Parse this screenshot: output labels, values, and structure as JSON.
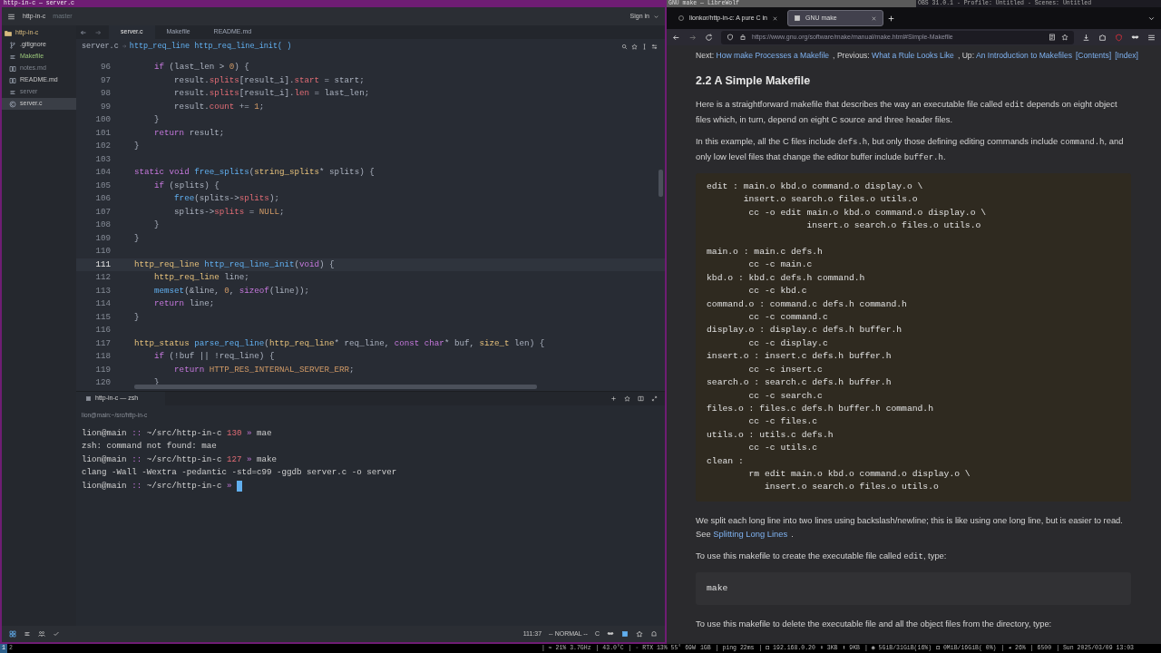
{
  "editor": {
    "window_title": "http-in-c — server.c",
    "project": "http-in-c",
    "branch": "master",
    "sign_in": "Sign in",
    "sidebar": {
      "root": "http-in-c",
      "items": [
        {
          "label": ".gitignore",
          "kind": "git",
          "added": false,
          "ignored": false,
          "selected": false
        },
        {
          "label": "Makefile",
          "kind": "lines",
          "added": true,
          "ignored": false,
          "selected": false
        },
        {
          "label": "notes.md",
          "kind": "book",
          "added": false,
          "ignored": true,
          "selected": false
        },
        {
          "label": "README.md",
          "kind": "book",
          "added": false,
          "ignored": false,
          "selected": false
        },
        {
          "label": "server",
          "kind": "lines",
          "added": false,
          "ignored": true,
          "selected": false
        },
        {
          "label": "server.c",
          "kind": "c",
          "added": false,
          "ignored": false,
          "selected": true
        }
      ]
    },
    "tabs": [
      {
        "label": "server.c",
        "selected": true
      },
      {
        "label": "Makefile",
        "selected": false
      },
      {
        "label": "README.md",
        "selected": false
      }
    ],
    "breadcrumb": [
      "server.c",
      "http_req_line http_req_line_init( )"
    ],
    "code": [
      {
        "n": "96",
        "current": false,
        "tokens": [
          {
            "kind": "keyword",
            "text": "    if"
          },
          {
            "kind": "plain",
            "text": " (last_len > "
          },
          {
            "kind": "number",
            "text": "0"
          },
          {
            "kind": "plain",
            "text": ") {"
          }
        ]
      },
      {
        "n": "97",
        "current": false,
        "tokens": [
          {
            "kind": "plain",
            "text": "        result."
          },
          {
            "kind": "member",
            "text": "splits"
          },
          {
            "kind": "plain",
            "text": "[result_i]."
          },
          {
            "kind": "member",
            "text": "start"
          },
          {
            "kind": "plain",
            "text": " = start;"
          }
        ]
      },
      {
        "n": "98",
        "current": false,
        "tokens": [
          {
            "kind": "plain",
            "text": "        result."
          },
          {
            "kind": "member",
            "text": "splits"
          },
          {
            "kind": "plain",
            "text": "[result_i]."
          },
          {
            "kind": "member",
            "text": "len"
          },
          {
            "kind": "plain",
            "text": " = last_len;"
          }
        ]
      },
      {
        "n": "99",
        "current": false,
        "tokens": [
          {
            "kind": "plain",
            "text": "        result."
          },
          {
            "kind": "member",
            "text": "count"
          },
          {
            "kind": "plain",
            "text": " += "
          },
          {
            "kind": "number",
            "text": "1"
          },
          {
            "kind": "plain",
            "text": ";"
          }
        ]
      },
      {
        "n": "100",
        "current": false,
        "tokens": [
          {
            "kind": "plain",
            "text": "    }"
          }
        ]
      },
      {
        "n": "101",
        "current": false,
        "tokens": [
          {
            "kind": "keyword",
            "text": "    return"
          },
          {
            "kind": "plain",
            "text": " result;"
          }
        ]
      },
      {
        "n": "102",
        "current": false,
        "tokens": [
          {
            "kind": "plain",
            "text": "}"
          }
        ]
      },
      {
        "n": "103",
        "current": false
      },
      {
        "n": "104",
        "current": false,
        "tokens": [
          {
            "kind": "keyword",
            "text": "static void"
          },
          {
            "kind": "function",
            "text": " free_splits"
          },
          {
            "kind": "plain",
            "text": "("
          },
          {
            "kind": "type",
            "text": "string_splits"
          },
          {
            "kind": "plain",
            "text": "* splits) {"
          }
        ]
      },
      {
        "n": "105",
        "current": false,
        "tokens": [
          {
            "kind": "keyword",
            "text": "    if"
          },
          {
            "kind": "plain",
            "text": " (splits) {"
          }
        ]
      },
      {
        "n": "106",
        "current": false,
        "tokens": [
          {
            "kind": "function",
            "text": "        free"
          },
          {
            "kind": "plain",
            "text": "(splits->"
          },
          {
            "kind": "member",
            "text": "splits"
          },
          {
            "kind": "plain",
            "text": ");"
          }
        ]
      },
      {
        "n": "107",
        "current": false,
        "tokens": [
          {
            "kind": "plain",
            "text": "        splits->"
          },
          {
            "kind": "member",
            "text": "splits"
          },
          {
            "kind": "plain",
            "text": " = "
          },
          {
            "kind": "number",
            "text": "NULL"
          },
          {
            "kind": "plain",
            "text": ";"
          }
        ]
      },
      {
        "n": "108",
        "current": false,
        "tokens": [
          {
            "kind": "plain",
            "text": "    }"
          }
        ]
      },
      {
        "n": "109",
        "current": false,
        "tokens": [
          {
            "kind": "plain",
            "text": "}"
          }
        ]
      },
      {
        "n": "110",
        "current": false
      },
      {
        "n": "111",
        "current": true,
        "tokens": [
          {
            "kind": "type",
            "text": "http_req_line"
          },
          {
            "kind": "function",
            "text": " http_req_line_init"
          },
          {
            "kind": "plain",
            "text": "("
          },
          {
            "kind": "keyword",
            "text": "void"
          },
          {
            "kind": "plain",
            "text": ") {"
          }
        ]
      },
      {
        "n": "112",
        "current": false,
        "tokens": [
          {
            "kind": "type",
            "text": "    http_req_line"
          },
          {
            "kind": "plain",
            "text": " line;"
          }
        ]
      },
      {
        "n": "113",
        "current": false,
        "tokens": [
          {
            "kind": "function",
            "text": "    memset"
          },
          {
            "kind": "plain",
            "text": "(&line, "
          },
          {
            "kind": "number",
            "text": "0"
          },
          {
            "kind": "plain",
            "text": ", "
          },
          {
            "kind": "keyword",
            "text": "sizeof"
          },
          {
            "kind": "plain",
            "text": "(line));"
          }
        ]
      },
      {
        "n": "114",
        "current": false,
        "tokens": [
          {
            "kind": "keyword",
            "text": "    return"
          },
          {
            "kind": "plain",
            "text": " line;"
          }
        ]
      },
      {
        "n": "115",
        "current": false,
        "tokens": [
          {
            "kind": "plain",
            "text": "}"
          }
        ]
      },
      {
        "n": "116",
        "current": false
      },
      {
        "n": "117",
        "current": false,
        "tokens": [
          {
            "kind": "type",
            "text": "http_status"
          },
          {
            "kind": "function",
            "text": " parse_req_line"
          },
          {
            "kind": "plain",
            "text": "("
          },
          {
            "kind": "type",
            "text": "http_req_line"
          },
          {
            "kind": "plain",
            "text": "* req_line, "
          },
          {
            "kind": "keyword",
            "text": "const char"
          },
          {
            "kind": "plain",
            "text": "* buf, "
          },
          {
            "kind": "type",
            "text": "size_t"
          },
          {
            "kind": "plain",
            "text": " len) {"
          }
        ]
      },
      {
        "n": "118",
        "current": false,
        "tokens": [
          {
            "kind": "keyword",
            "text": "    if"
          },
          {
            "kind": "plain",
            "text": " (!buf || !req_line) {"
          }
        ]
      },
      {
        "n": "119",
        "current": false,
        "tokens": [
          {
            "kind": "keyword",
            "text": "        return"
          },
          {
            "kind": "number",
            "text": " HTTP_RES_INTERNAL_SERVER_ERR"
          },
          {
            "kind": "plain",
            "text": ";"
          }
        ]
      },
      {
        "n": "120",
        "current": false,
        "tokens": [
          {
            "kind": "plain",
            "text": "    }"
          }
        ]
      }
    ],
    "terminal": {
      "tab": "http-in-c — zsh",
      "header": "lion@main:~/src/http-in-c",
      "lines": [
        {
          "kind": "prompt",
          "user": "lion@main",
          "sep": "::",
          "path": "~/src/http-in-c",
          "code": "130",
          "arrow": "»",
          "command": "mae"
        },
        {
          "kind": "output",
          "text": "zsh: command not found: mae"
        },
        {
          "kind": "prompt",
          "user": "lion@main",
          "sep": "::",
          "path": "~/src/http-in-c",
          "code": "127",
          "arrow": "»",
          "command": "make"
        },
        {
          "kind": "output",
          "text": "clang -Wall -Wextra -pedantic -std=c99 -ggdb server.c -o server"
        },
        {
          "kind": "prompt",
          "user": "lion@main",
          "sep": "::",
          "path": "~/src/http-in-c",
          "arrow": "»",
          "cursor": true
        }
      ]
    },
    "status": {
      "position": "111:37",
      "mode": "-- NORMAL --",
      "language": "C"
    }
  },
  "browser": {
    "window_title": "GNU make — LibreWolf",
    "obs_title": "OBS 31.0.1 - Profile: Untitled - Scenes: Untitled",
    "tabs": [
      {
        "label": "lionkor/http-in-c: A pure C in",
        "selected": false
      },
      {
        "label": "GNU make",
        "selected": true
      }
    ],
    "url": "https://www.gnu.org/software/make/manual/make.html#Simple-Makefile",
    "nav": [
      {
        "kind": "text",
        "text": "Next: "
      },
      {
        "kind": "link",
        "text": "How make Processes a Makefile"
      },
      {
        "kind": "text",
        "text": ", Previous: "
      },
      {
        "kind": "link",
        "text": "What a Rule Looks Like"
      },
      {
        "kind": "text",
        "text": ", Up: "
      },
      {
        "kind": "link",
        "text": "An Introduction to Makefiles"
      },
      {
        "kind": "link",
        "text": "[Contents]"
      },
      {
        "kind": "link",
        "text": "[Index]"
      }
    ],
    "heading": "2.2 A Simple Makefile",
    "blocks": [
      {
        "kind": "para",
        "parts": [
          {
            "kind": "text",
            "text": "Here is a straightforward makefile that describes the way an executable file called "
          },
          {
            "kind": "code",
            "text": "edit"
          },
          {
            "kind": "text",
            "text": " depends on eight object files which, in turn, depend on eight C source and three header files."
          }
        ]
      },
      {
        "kind": "para",
        "parts": [
          {
            "kind": "text",
            "text": "In this example, all the C files include "
          },
          {
            "kind": "code",
            "text": "defs.h"
          },
          {
            "kind": "text",
            "text": ", but only those defining editing commands include "
          },
          {
            "kind": "code",
            "text": "command.h"
          },
          {
            "kind": "text",
            "text": ", and only low level files that change the editor buffer include "
          },
          {
            "kind": "code",
            "text": "buffer.h"
          },
          {
            "kind": "text",
            "text": "."
          }
        ]
      },
      {
        "kind": "code_example",
        "text": "edit : main.o kbd.o command.o display.o \\\n       insert.o search.o files.o utils.o\n        cc -o edit main.o kbd.o command.o display.o \\\n                   insert.o search.o files.o utils.o\n\nmain.o : main.c defs.h\n        cc -c main.c\nkbd.o : kbd.c defs.h command.h\n        cc -c kbd.c\ncommand.o : command.c defs.h command.h\n        cc -c command.c\ndisplay.o : display.c defs.h buffer.h\n        cc -c display.c\ninsert.o : insert.c defs.h buffer.h\n        cc -c insert.c\nsearch.o : search.c defs.h buffer.h\n        cc -c search.c\nfiles.o : files.c defs.h buffer.h command.h\n        cc -c files.c\nutils.o : utils.c defs.h\n        cc -c utils.c\nclean :\n        rm edit main.o kbd.o command.o display.o \\\n           insert.o search.o files.o utils.o"
      },
      {
        "kind": "para",
        "parts": [
          {
            "kind": "text",
            "text": "We split each long line into two lines using backslash/newline; this is like using one long line, but is easier to read. See "
          },
          {
            "kind": "link",
            "text": "Splitting Long Lines"
          },
          {
            "kind": "text",
            "text": "."
          }
        ]
      },
      {
        "kind": "para",
        "parts": [
          {
            "kind": "text",
            "text": "To use this makefile to create the executable file called "
          },
          {
            "kind": "code",
            "text": "edit"
          },
          {
            "kind": "text",
            "text": ", type:"
          }
        ]
      },
      {
        "kind": "code_command",
        "text": "make"
      },
      {
        "kind": "para",
        "parts": [
          {
            "kind": "text",
            "text": "To use this makefile to delete the executable file and all the object files from the directory, type:"
          }
        ]
      }
    ]
  },
  "system_bar": {
    "workspaces": [
      {
        "label": "1",
        "selected": true
      },
      {
        "label": "2",
        "selected": false
      }
    ],
    "stats": [
      "| ≈ 21% 3.7GHz",
      "| 43.0°C",
      "| ◦ RTX 13% 55° 69W",
      "1GB",
      "| ping 22ms",
      "| ◘ 192.168.0.20",
      "⬇ 3KB",
      "⬆ 9KB",
      "| ◉ 5GiB/31GiB(16%)",
      "◘ 0MiB/16GiB( 0%)",
      "| ◂ 26%",
      "| 6500",
      "| Sun 2025/03/09 13:03"
    ]
  }
}
